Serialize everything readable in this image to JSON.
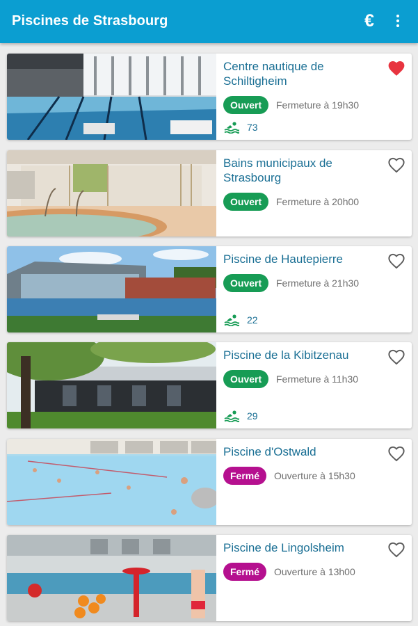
{
  "app": {
    "title": "Piscines de Strasbourg",
    "euro_icon": "€",
    "accent_color": "#0b9ed1"
  },
  "colors": {
    "open": "#179c55",
    "closed": "#b5108f",
    "favorite": "#e8343f"
  },
  "pools": [
    {
      "name": "Centre nautique de Schiltigheim",
      "status": "Ouvert",
      "hours": "Fermeture à 19h30",
      "visitors": "73",
      "favorite": true
    },
    {
      "name": "Bains municipaux de Strasbourg",
      "status": "Ouvert",
      "hours": "Fermeture à 20h00",
      "favorite": false
    },
    {
      "name": "Piscine de Hautepierre",
      "status": "Ouvert",
      "hours": "Fermeture à 21h30",
      "visitors": "22",
      "favorite": false
    },
    {
      "name": "Piscine de la Kibitzenau",
      "status": "Ouvert",
      "hours": "Fermeture à 11h30",
      "visitors": "29",
      "favorite": false
    },
    {
      "name": "Piscine d'Ostwald",
      "status": "Fermé",
      "hours": "Ouverture à 15h30",
      "favorite": false
    },
    {
      "name": "Piscine de Lingolsheim",
      "status": "Fermé",
      "hours": "Ouverture à 13h00",
      "favorite": false
    }
  ]
}
